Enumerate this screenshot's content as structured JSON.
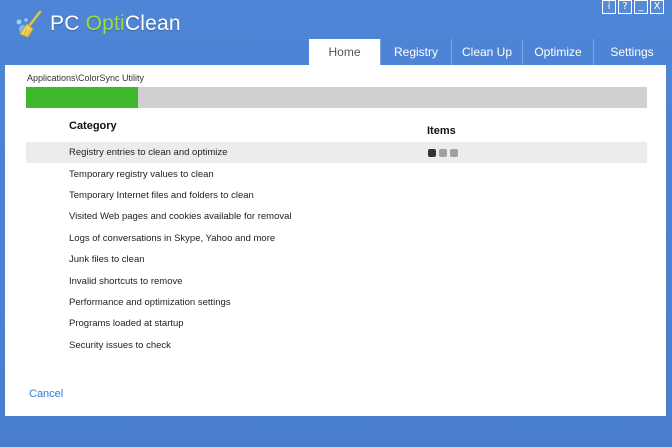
{
  "app": {
    "logo_prefix": "PC ",
    "logo_opti": "Opti",
    "logo_suffix": "Clean"
  },
  "window_controls": [
    {
      "name": "info",
      "glyph": "i"
    },
    {
      "name": "help",
      "glyph": "?"
    },
    {
      "name": "minimize",
      "glyph": "_"
    },
    {
      "name": "close",
      "glyph": "X"
    }
  ],
  "tabs": [
    {
      "label": "Home",
      "active": true
    },
    {
      "label": "Registry"
    },
    {
      "label": "Clean Up"
    },
    {
      "label": "Optimize"
    },
    {
      "label": "Settings"
    }
  ],
  "scan": {
    "path": "Applications\\ColorSync Utility",
    "progress_percent": 18
  },
  "table": {
    "col_category": "Category",
    "col_items": "Items",
    "rows": [
      {
        "label": "Registry entries to clean and optimize",
        "active": true
      },
      {
        "label": "Temporary registry values to clean"
      },
      {
        "label": "Temporary Internet files and folders to clean"
      },
      {
        "label": "Visited Web pages and cookies available for removal"
      },
      {
        "label": "Logs of conversations in Skype, Yahoo and more"
      },
      {
        "label": "Junk files to clean"
      },
      {
        "label": "Invalid shortcuts to remove"
      },
      {
        "label": "Performance and optimization settings"
      },
      {
        "label": "Programs loaded at startup"
      },
      {
        "label": "Security issues to check"
      }
    ]
  },
  "actions": {
    "cancel_label": "Cancel"
  },
  "colors": {
    "background": "#4a7fd0",
    "progress": "#3fb72d",
    "accent_link": "#2e7fd4",
    "logo_green": "#9be03a"
  }
}
